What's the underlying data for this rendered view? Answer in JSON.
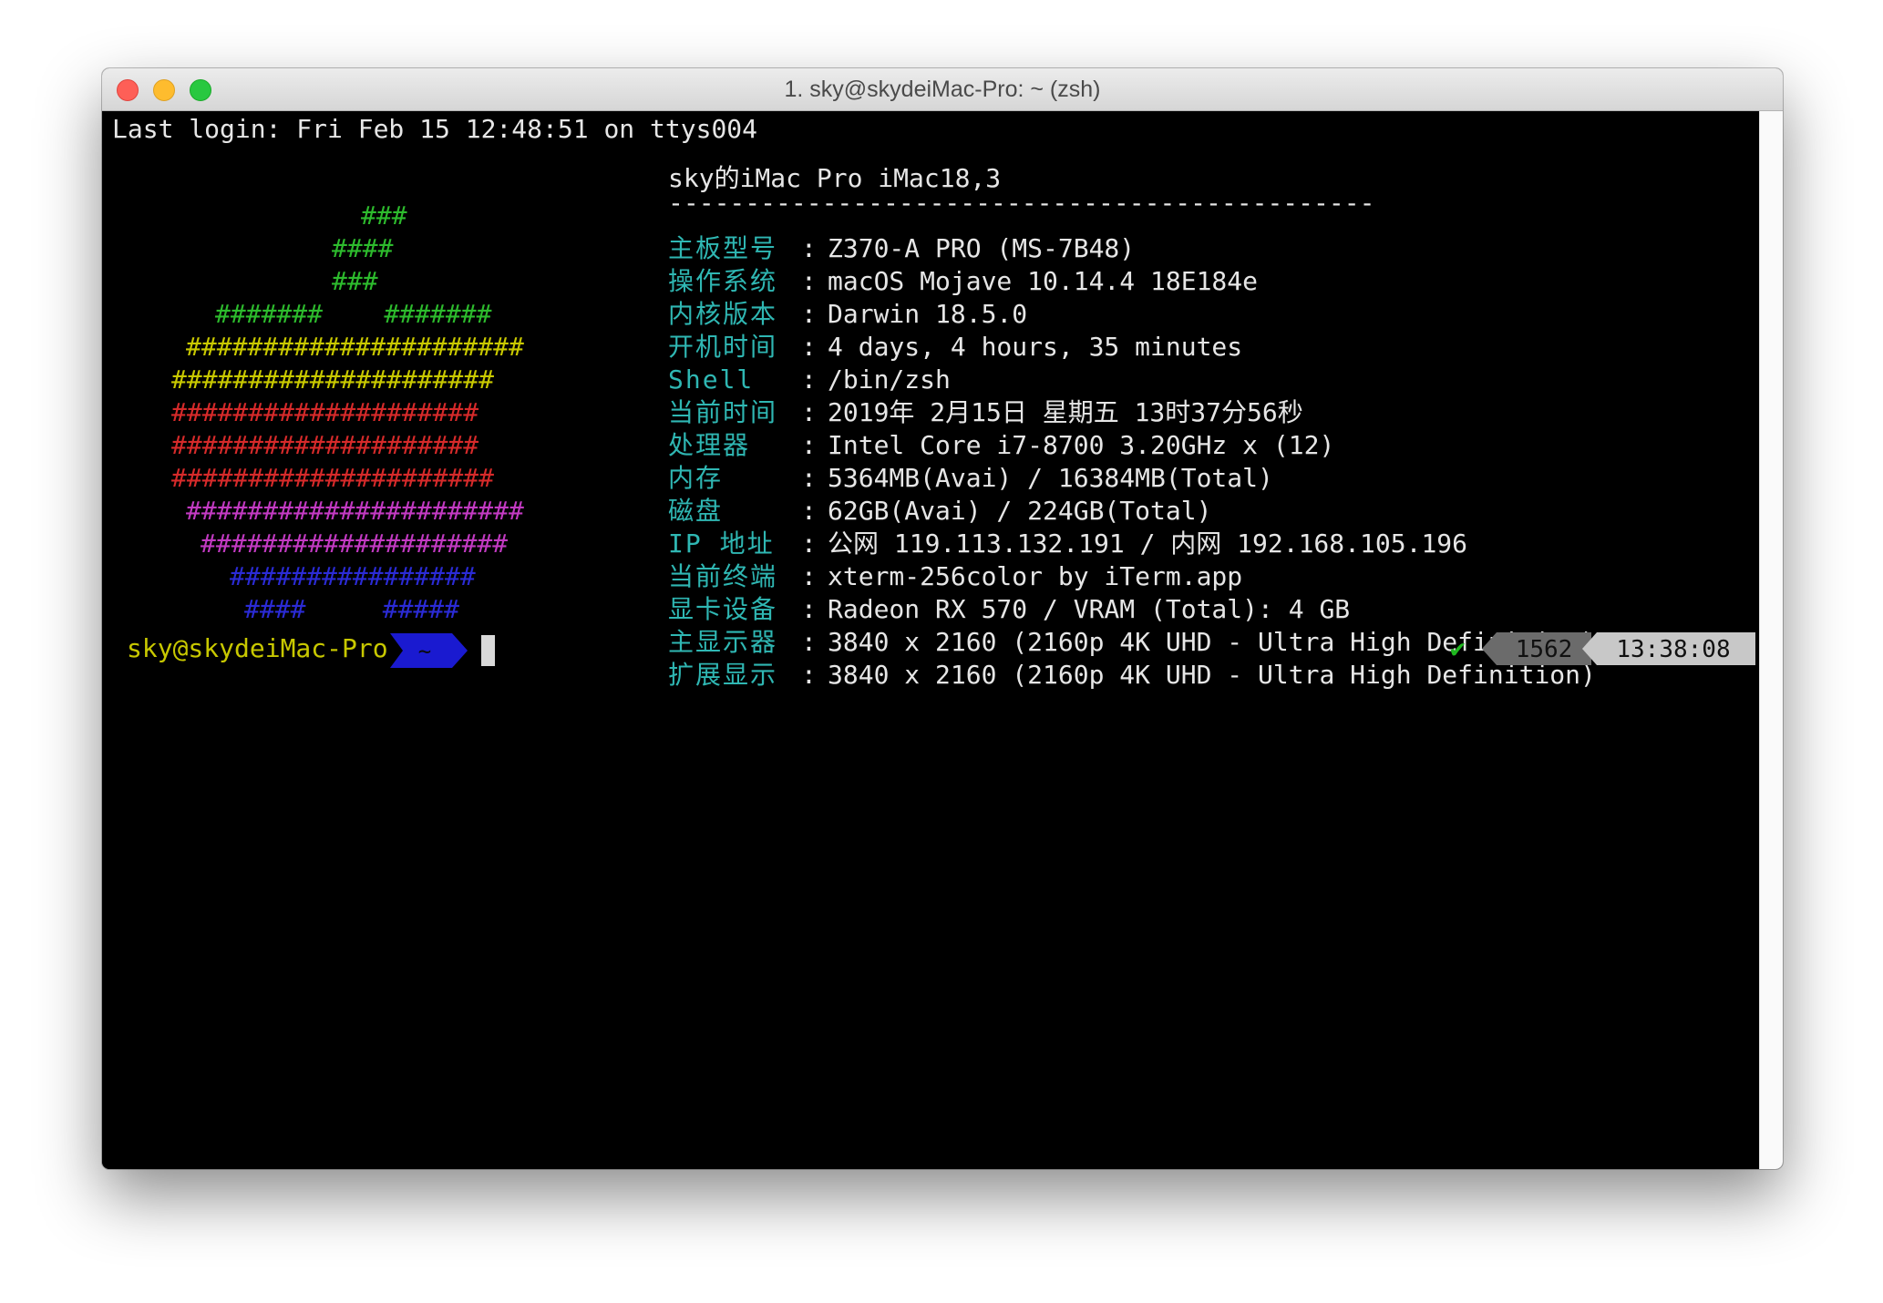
{
  "window": {
    "title": "1. sky@skydeiMac-Pro: ~ (zsh)"
  },
  "terminal": {
    "last_login": "Last login: Fri Feb 15 12:48:51 on ttys004",
    "logo": [
      {
        "text": "###",
        "color": "#2dbb2d"
      },
      {
        "text": "####",
        "color": "#2dbb2d"
      },
      {
        "text": "###",
        "color": "#2dbb2d"
      },
      {
        "text": "#######    #######",
        "color": "#2dbb2d"
      },
      {
        "text": "######################",
        "color": "#c9c900"
      },
      {
        "text": "#####################",
        "color": "#c9c900"
      },
      {
        "text": "####################",
        "color": "#d62a2a"
      },
      {
        "text": "####################",
        "color": "#d62a2a"
      },
      {
        "text": "#####################",
        "color": "#d62a2a"
      },
      {
        "text": "######################",
        "color": "#c23ac2"
      },
      {
        "text": "####################",
        "color": "#c23ac2"
      },
      {
        "text": "################",
        "color": "#2b2bd6"
      },
      {
        "text": "####     #####",
        "color": "#2b2bd6"
      }
    ],
    "host_header": "sky的iMac Pro iMac18,3",
    "separator": "----------------------------------------------",
    "info": [
      {
        "key": "主板型号",
        "value": "Z370-A PRO (MS-7B48)"
      },
      {
        "key": "操作系统",
        "value": "macOS Mojave 10.14.4 18E184e"
      },
      {
        "key": "内核版本",
        "value": "Darwin 18.5.0"
      },
      {
        "key": "开机时间",
        "value": "4 days, 4 hours, 35 minutes"
      },
      {
        "key": "Shell",
        "value": "/bin/zsh"
      },
      {
        "key": "当前时间",
        "value": "2019年 2月15日 星期五 13时37分56秒"
      },
      {
        "key": "处理器",
        "value": "Intel Core i7-8700 3.20GHz x (12)"
      },
      {
        "key": "内存",
        "value": "5364MB(Avai) / 16384MB(Total)"
      },
      {
        "key": "磁盘",
        "value": "62GB(Avai) / 224GB(Total)"
      },
      {
        "key": "IP 地址",
        "value": "公网 119.113.132.191 / 内网 192.168.105.196"
      },
      {
        "key": "当前终端",
        "value": "xterm-256color by iTerm.app"
      },
      {
        "key": "显卡设备",
        "value": "Radeon RX 570 / VRAM (Total): 4 GB"
      },
      {
        "key": "主显示器",
        "value": "3840 x 2160 (2160p 4K UHD - Ultra High Definition)"
      },
      {
        "key": "扩展显示",
        "value": "3840 x 2160 (2160p 4K UHD - Ultra High Definition)"
      }
    ],
    "colon": ":",
    "prompt": {
      "user_host": "sky@skydeiMac-Pro",
      "dir": "~",
      "status_icon": "✔",
      "history_number": "1562",
      "time": "13:38:08"
    },
    "colors": {
      "key": "#2fb7b3",
      "prompt_user": "#c8c800",
      "dir_segment": "#1a1ad0",
      "history_segment": "#6b6b6b",
      "time_segment": "#c8c8c8",
      "status_ok": "#1fb81f"
    }
  }
}
